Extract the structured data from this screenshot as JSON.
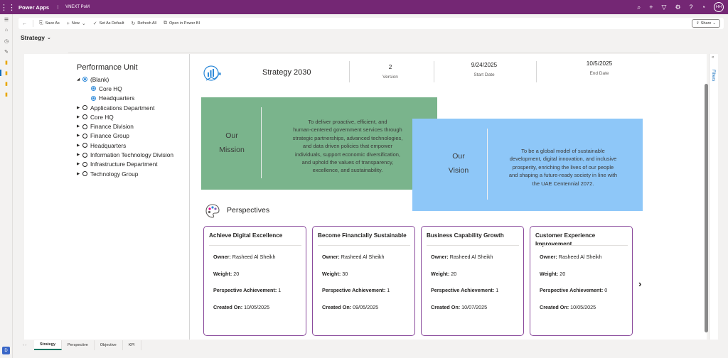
{
  "header": {
    "app_name": "Power Apps",
    "environment": "VNEXT PoM",
    "avatar_initials": "HH"
  },
  "colors": {
    "header": "#742774",
    "mission_bg": "#7ab48c",
    "vision_bg": "#8ec7f8",
    "card_border": "#8a4a9c",
    "active_tab": "#117865"
  },
  "command_bar": {
    "save_as": "Save As",
    "new": "New",
    "set_default": "Set As Default",
    "refresh_all": "Refresh All",
    "open_power_bi": "Open in Power BI",
    "share": "Share"
  },
  "page": {
    "title": "Strategy"
  },
  "report": {
    "slicer": {
      "title": "Performance Unit",
      "items": [
        {
          "label": "(Blank)",
          "expanded": true,
          "selected": true
        },
        {
          "label": "Core HQ",
          "child": true,
          "selected": true
        },
        {
          "label": "Headquarters",
          "child": true,
          "selected": true
        },
        {
          "label": "Applications Department"
        },
        {
          "label": "Core HQ"
        },
        {
          "label": "Finance Division"
        },
        {
          "label": "Finance Group"
        },
        {
          "label": "Headquarters"
        },
        {
          "label": "Information Technology Division"
        },
        {
          "label": "Infrastructure Department"
        },
        {
          "label": "Technology Group"
        }
      ]
    },
    "strategy": {
      "name": "Strategy 2030",
      "version": "2",
      "version_label": "Version",
      "start_date": "9/24/2025",
      "start_date_label": "Start Date",
      "end_date": "10/5/2025",
      "end_date_label": "End Date"
    },
    "mission": {
      "heading_1": "Our",
      "heading_2": "Mission",
      "lines": [
        "To deliver proactive, efficient, and",
        "human-centered government services through",
        "strategic partnerships, advanced technologies,",
        "and data driven policies that empower",
        "individuals, support economic diversification,",
        "and uphold the values of transparency,",
        "excellence, and sustainability."
      ]
    },
    "vision": {
      "heading_1": "Our",
      "heading_2": "Vision",
      "lines": [
        "To be a global model of sustainable",
        "development, digital innovation, and inclusive",
        "prosperity, enriching the lives of our people",
        "and shaping a future-ready society in line with",
        "the UAE Centennial 2072."
      ]
    },
    "perspectives": {
      "title": "Perspectives",
      "field_labels": {
        "owner": "Owner:",
        "weight": "Weight:",
        "achievement": "Perspective Achievement:",
        "created": "Created On:"
      },
      "cards": [
        {
          "title": "Achieve Digital Excellence",
          "owner": "Rasheed Al Sheikh",
          "weight": "20",
          "achievement": "1",
          "created": "10/05/2025"
        },
        {
          "title": "Become Financially Sustainable",
          "owner": "Rasheed Al Sheikh",
          "weight": "30",
          "achievement": "1",
          "created": "09/05/2025"
        },
        {
          "title": "Business Capability Growth",
          "owner": "Rasheed Al Sheikh",
          "weight": "20",
          "achievement": "1",
          "created": "10/07/2025"
        },
        {
          "title": "Customer Experience Improvement",
          "owner": "Rasheed Al Sheikh",
          "weight": "20",
          "achievement": "0",
          "created": "10/05/2025"
        }
      ]
    },
    "filters_label": "Filters"
  },
  "tabs": [
    "Strategy",
    "Perspective",
    "Objective",
    "KPI"
  ],
  "active_tab": "Strategy"
}
